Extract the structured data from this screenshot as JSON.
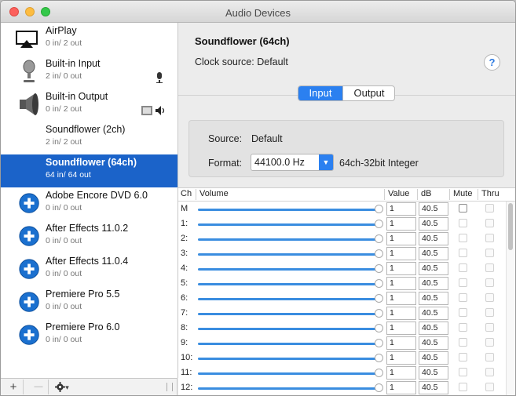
{
  "window": {
    "title": "Audio Devices"
  },
  "devices": [
    {
      "name": "AirPlay",
      "io": "0 in/ 2 out",
      "icon": "airplay-icon"
    },
    {
      "name": "Built-in Input",
      "io": "2 in/ 0 out",
      "icon": "microphone-icon"
    },
    {
      "name": "Built-in Output",
      "io": "0 in/ 2 out",
      "icon": "speaker-icon"
    },
    {
      "name": "Soundflower (2ch)",
      "io": "2 in/ 2 out",
      "icon": ""
    },
    {
      "name": "Soundflower (64ch)",
      "io": "64 in/ 64 out",
      "icon": "",
      "selected": true
    },
    {
      "name": "Adobe Encore DVD 6.0",
      "io": "0 in/ 0 out",
      "icon": "plus-circle-icon"
    },
    {
      "name": "After Effects 11.0.2",
      "io": "0 in/ 0 out",
      "icon": "plus-circle-icon"
    },
    {
      "name": "After Effects 11.0.4",
      "io": "0 in/ 0 out",
      "icon": "plus-circle-icon"
    },
    {
      "name": "Premiere Pro 5.5",
      "io": "0 in/ 0 out",
      "icon": "plus-circle-icon"
    },
    {
      "name": "Premiere Pro 6.0",
      "io": "0 in/ 0 out",
      "icon": "plus-circle-icon"
    }
  ],
  "footer": {
    "add": "+",
    "remove": "—",
    "gear_caret": "▾"
  },
  "detail": {
    "title": "Soundflower (64ch)",
    "clock_label": "Clock source:",
    "clock_value": "Default",
    "help": "?",
    "tabs": [
      "Input",
      "Output"
    ],
    "selected_tab": "Input",
    "source_label": "Source:",
    "source_value": "Default",
    "format_label": "Format:",
    "format_value": "44100.0 Hz",
    "format_desc": "64ch-32bit Integer"
  },
  "table": {
    "headers": {
      "ch": "Ch",
      "volume": "Volume",
      "value": "Value",
      "db": "dB",
      "mute": "Mute",
      "thru": "Thru"
    },
    "rows": [
      {
        "ch": "M",
        "value": "1",
        "db": "40.5"
      },
      {
        "ch": "1:",
        "value": "1",
        "db": "40.5"
      },
      {
        "ch": "2:",
        "value": "1",
        "db": "40.5"
      },
      {
        "ch": "3:",
        "value": "1",
        "db": "40.5"
      },
      {
        "ch": "4:",
        "value": "1",
        "db": "40.5"
      },
      {
        "ch": "5:",
        "value": "1",
        "db": "40.5"
      },
      {
        "ch": "6:",
        "value": "1",
        "db": "40.5"
      },
      {
        "ch": "7:",
        "value": "1",
        "db": "40.5"
      },
      {
        "ch": "8:",
        "value": "1",
        "db": "40.5"
      },
      {
        "ch": "9:",
        "value": "1",
        "db": "40.5"
      },
      {
        "ch": "10:",
        "value": "1",
        "db": "40.5"
      },
      {
        "ch": "11:",
        "value": "1",
        "db": "40.5"
      },
      {
        "ch": "12:",
        "value": "1",
        "db": "40.5"
      }
    ]
  },
  "colors": {
    "selection": "#1b63c9",
    "accent": "#2b80f0",
    "slider": "#3a8de0"
  }
}
